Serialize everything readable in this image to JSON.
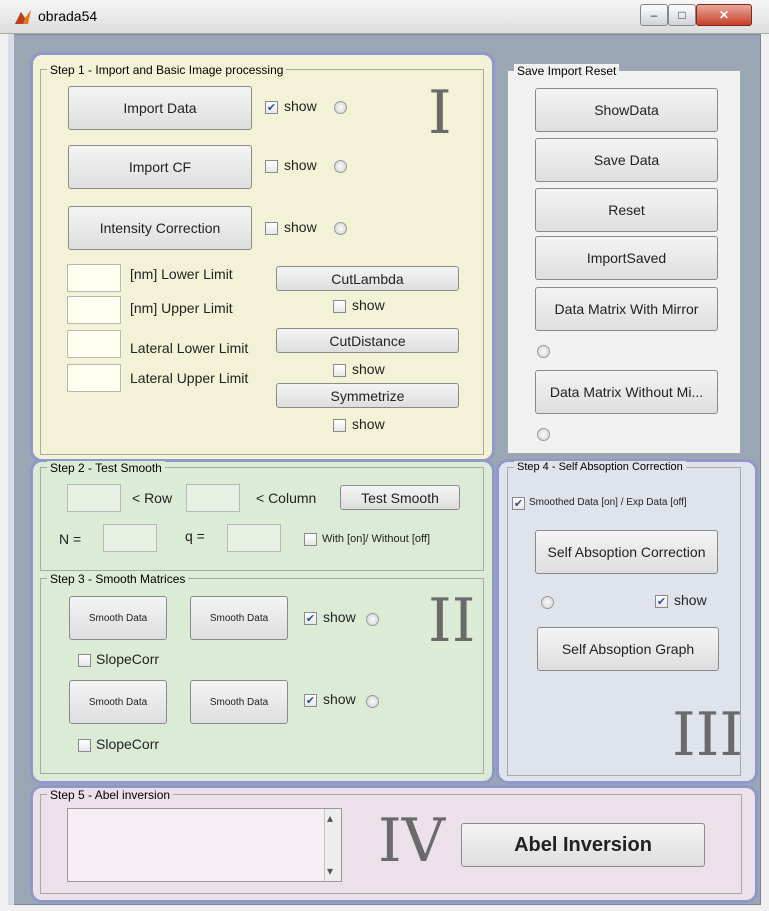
{
  "window": {
    "title": "obrada54",
    "colors": {
      "panel_border": "#8f98c8",
      "step1_bg": "#f3f1d6",
      "step23_bg": "#dcebd6",
      "step4_bg": "#dfe4ec",
      "step5_bg": "#ece0ea"
    }
  },
  "step1": {
    "legend": "Step 1 - Import and Basic Image processing",
    "roman": "I",
    "import_data": "Import Data",
    "import_cf": "Import CF",
    "intensity_correction": "Intensity Correction",
    "show": "show",
    "lower_limit": "[nm] Lower Limit",
    "upper_limit": "[nm] Upper Limit",
    "lateral_lower": "Lateral Lower Limit",
    "lateral_upper": "Lateral Upper Limit",
    "cut_lambda": "CutLambda",
    "cut_distance": "CutDistance",
    "symmetrize": "Symmetrize",
    "show_import_data_checked": true
  },
  "save_panel": {
    "legend": "Save Import Reset",
    "show_data": "ShowData",
    "save_data": "Save Data",
    "reset": "Reset",
    "import_saved": "ImportSaved",
    "matrix_with_mirror": "Data Matrix With Mirror",
    "matrix_without_mirror": "Data Matrix Without Mi..."
  },
  "step2": {
    "legend": "Step 2 - Test Smooth",
    "row": "< Row",
    "column": "< Column",
    "test_smooth": "Test Smooth",
    "n_label": "N =",
    "q_label": "q =",
    "with_without": "With [on]/ Without [off]"
  },
  "step3": {
    "legend": "Step 3 - Smooth Matrices",
    "roman": "II",
    "smooth_data": "Smooth Data",
    "show": "show",
    "slope_corr": "SlopeCorr"
  },
  "step4": {
    "legend": "Step 4 - Self Absoption Correction",
    "roman": "III",
    "smoothed_exp": "Smoothed Data [on] / Exp Data [off]",
    "self_absorption_correction": "Self Absoption Correction",
    "show": "show",
    "self_absorption_graph": "Self Absoption Graph"
  },
  "step5": {
    "legend": "Step 5 - Abel inversion",
    "roman": "IV",
    "abel_inversion": "Abel Inversion"
  },
  "icons": {
    "check": "✔",
    "scroll_up": "▴",
    "scroll_down": "▾"
  }
}
